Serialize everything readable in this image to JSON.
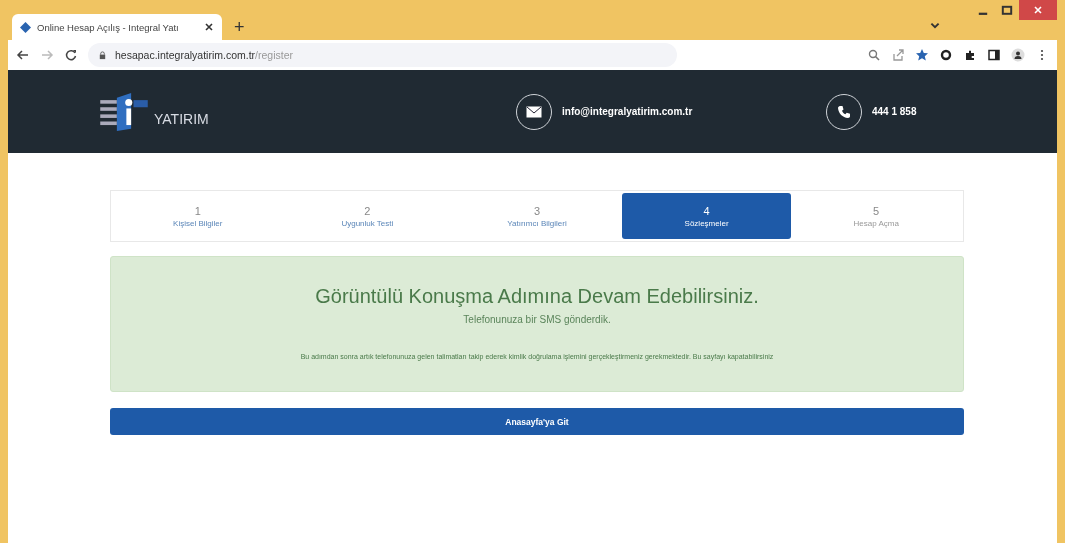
{
  "browser": {
    "tab_title": "Online Hesap Açılış - Integral Yatı",
    "new_tab": "+",
    "url_host": "hesapac.integralyatirim.com.tr",
    "url_path": "/register"
  },
  "header": {
    "logo_text": "YATIRIM",
    "email": "info@integralyatirim.com.tr",
    "phone": "444 1 858"
  },
  "steps": [
    {
      "number": "1",
      "label": "Kişisel Bilgiler",
      "selected": false
    },
    {
      "number": "2",
      "label": "Uygunluk Testi",
      "selected": false
    },
    {
      "number": "3",
      "label": "Yatırımcı Bilgileri",
      "selected": false
    },
    {
      "number": "4",
      "label": "Sözleşmeler",
      "selected": true
    },
    {
      "number": "5",
      "label": "Hesap Açma",
      "selected": false
    }
  ],
  "alert": {
    "title": "Görüntülü Konuşma Adımına Devam Edebilirsiniz.",
    "subtitle": "Telefonunuza bir SMS gönderdik.",
    "message": "Bu adımdan sonra artık telefonunuza gelen talimatları takip ederek kimlik doğrulama işlemini gerçekleştirmeniz gerekmektedir. Bu sayfayı kapatabilirsiniz"
  },
  "home_button": "Anasayfa'ya Git"
}
